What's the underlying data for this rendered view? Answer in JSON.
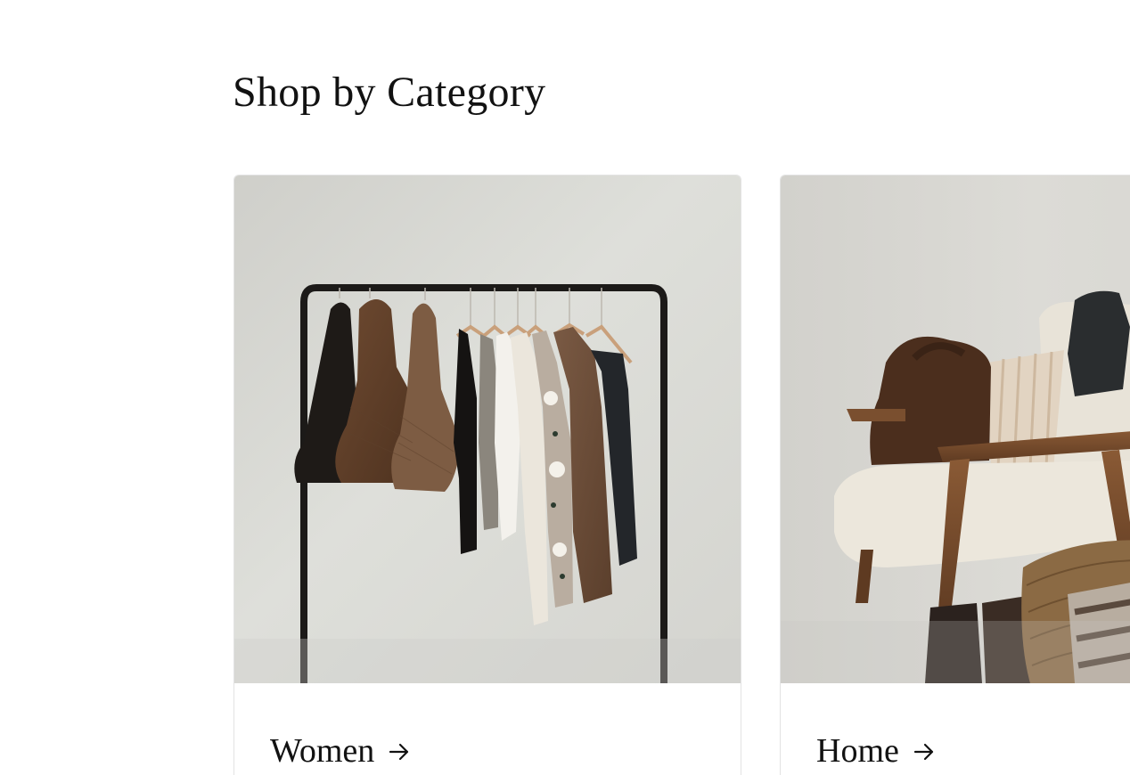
{
  "section": {
    "title": "Shop by Category"
  },
  "categories": [
    {
      "label": "Women",
      "image": "clothing-rack-photo",
      "icon": "arrow-right-icon"
    },
    {
      "label": "Home",
      "image": "armchair-photo",
      "icon": "arrow-right-icon"
    }
  ],
  "colors": {
    "text": "#121212",
    "card_border": "#e3e3e3",
    "background": "#ffffff"
  }
}
